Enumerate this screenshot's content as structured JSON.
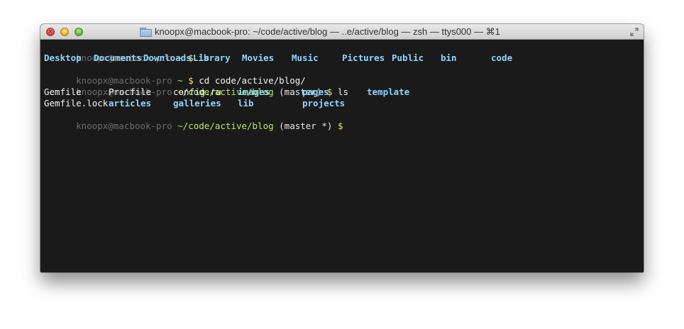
{
  "window": {
    "title": "knoopx@macbook-pro: ~/code/active/blog — ..e/active/blog — zsh — ttys000 — ⌘1",
    "close_glyph": "×",
    "icons": {
      "title": "folder-icon",
      "resize": "fullscreen-arrows-icon",
      "close": "close-button",
      "minimize": "minimize-button",
      "zoom": "zoom-button"
    }
  },
  "colors": {
    "terminal_bg": "#1a1a1a",
    "prompt_user": "#6b6b6b",
    "prompt_path": "#b8e85a",
    "prompt_dollar": "#f0e16a",
    "directory": "#8fd4ff",
    "file": "#f2f2f2"
  },
  "terminal": {
    "lines": [
      {
        "user": "knoopx@macbook-pro",
        "path": "~",
        "git": "",
        "dollar": "$",
        "command": "ls"
      },
      {
        "listing": [
          {
            "text": "Desktop",
            "type": "dir"
          },
          {
            "text": "Documents",
            "type": "dir"
          },
          {
            "text": "Downloads",
            "type": "dir"
          },
          {
            "text": "Library",
            "type": "dir"
          },
          {
            "text": "Movies",
            "type": "dir"
          },
          {
            "text": "Music",
            "type": "dir"
          },
          {
            "text": "Pictures",
            "type": "dir"
          },
          {
            "text": "Public",
            "type": "dir"
          },
          {
            "text": "bin",
            "type": "dir"
          },
          {
            "text": "code",
            "type": "dir"
          }
        ]
      },
      {
        "user": "knoopx@macbook-pro",
        "path": "~",
        "git": "",
        "dollar": "$",
        "command": "cd code/active/blog/"
      },
      {
        "user": "knoopx@macbook-pro",
        "path": "~/code/active/blog",
        "git": "(master)",
        "dollar": "$",
        "command": "ls"
      },
      {
        "listing": [
          {
            "text": "Gemfile",
            "type": "file"
          },
          {
            "text": "Procfile",
            "type": "file"
          },
          {
            "text": "config.ru",
            "type": "file"
          },
          {
            "text": "images",
            "type": "dir"
          },
          {
            "text": "pages",
            "type": "dir"
          },
          {
            "text": "template",
            "type": "dir"
          }
        ]
      },
      {
        "listing": [
          {
            "text": "Gemfile.lock",
            "type": "file"
          },
          {
            "text": "articles",
            "type": "dir"
          },
          {
            "text": "galleries",
            "type": "dir"
          },
          {
            "text": "lib",
            "type": "dir"
          },
          {
            "text": "projects",
            "type": "dir"
          }
        ]
      },
      {
        "user": "knoopx@macbook-pro",
        "path": "~/code/active/blog",
        "git": "(master *)",
        "dollar": "$",
        "command": ""
      }
    ]
  }
}
